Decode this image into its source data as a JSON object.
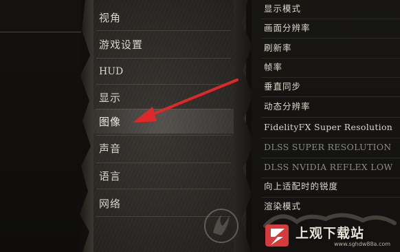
{
  "menu": {
    "items": [
      {
        "label": "视角"
      },
      {
        "label": "游戏设置"
      },
      {
        "label": "HUD"
      },
      {
        "label": "显示"
      },
      {
        "label": "图像"
      },
      {
        "label": "声音"
      },
      {
        "label": "语言"
      },
      {
        "label": "网络"
      }
    ],
    "selected": "图像"
  },
  "settings": {
    "items": [
      {
        "label": "显示模式"
      },
      {
        "label": "画面分辨率"
      },
      {
        "label": "刷新率"
      },
      {
        "label": "帧率"
      },
      {
        "label": "垂直同步"
      },
      {
        "label": "动态分辨率"
      },
      {
        "label": "FidelityFX Super Resolution"
      },
      {
        "label": "DLSS SUPER RESOLUTION"
      },
      {
        "label": "DLSS NVIDIA REFLEX LOW"
      },
      {
        "label": "向上适配时的锐度"
      },
      {
        "label": "渲染模式"
      }
    ]
  },
  "watermark": {
    "title": "上观下载站",
    "url": "www.sghdw88a.com",
    "logo_icon": "lightning-shield-icon",
    "highlight_color": "#d63b3b"
  },
  "annotation": {
    "arrow_color": "#e02828",
    "arrow_icon": "red-arrow-icon"
  }
}
